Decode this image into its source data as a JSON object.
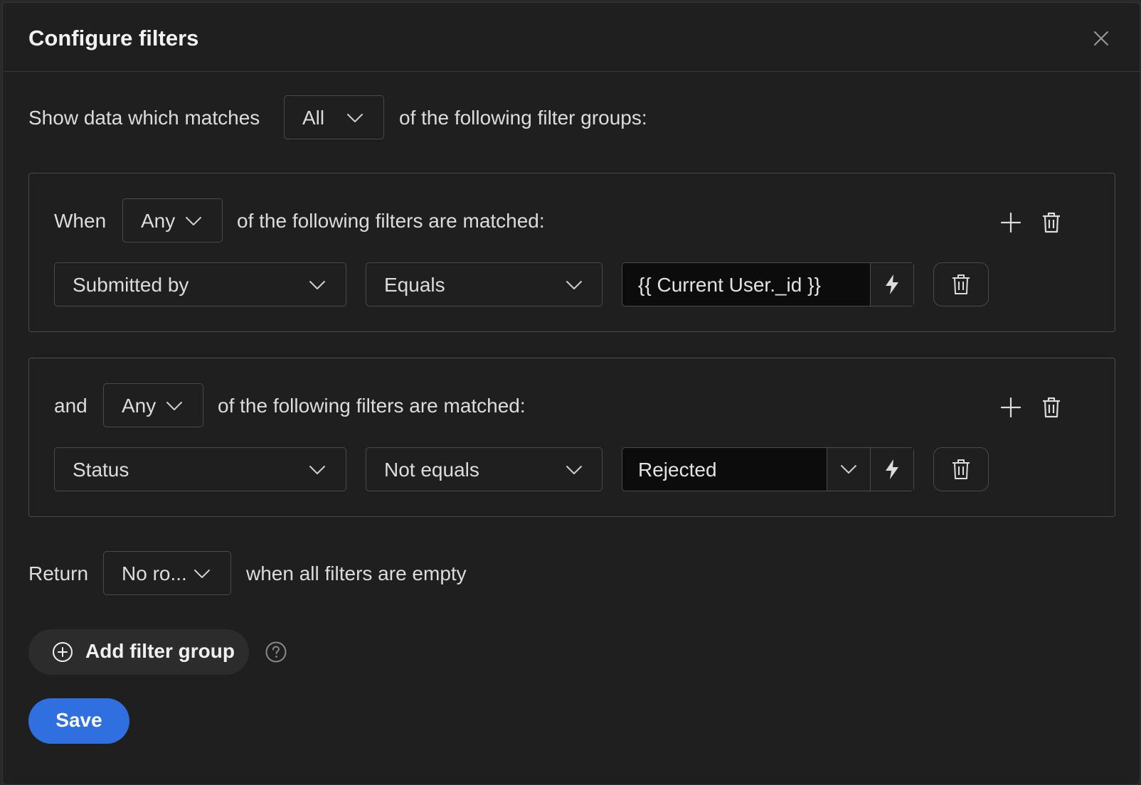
{
  "dialog": {
    "title": "Configure filters"
  },
  "match_row": {
    "prefix": "Show data which matches",
    "selected": "All",
    "suffix": "of the following filter groups:"
  },
  "groups": [
    {
      "prefix": "When",
      "selected": "Any",
      "suffix": "of the following filters are matched:",
      "filter": {
        "field": "Submitted by",
        "operator": "Equals",
        "value": "{{ Current User._id }}"
      }
    },
    {
      "prefix": "and",
      "selected": "Any",
      "suffix": "of the following filters are matched:",
      "filter": {
        "field": "Status",
        "operator": "Not equals",
        "value": "Rejected"
      }
    }
  ],
  "return_row": {
    "prefix": "Return",
    "selected": "No ro...",
    "suffix": "when all filters are empty"
  },
  "actions": {
    "add_group_label": "Add filter group",
    "save_label": "Save"
  },
  "colors": {
    "background": "#1f1f1f",
    "primary": "#2f6fe0",
    "border": "#4a4a4a"
  },
  "icons": [
    "close-icon",
    "chevron-down-icon",
    "plus-icon",
    "trash-icon",
    "lightning-icon",
    "plus-circle-icon",
    "help-icon"
  ]
}
